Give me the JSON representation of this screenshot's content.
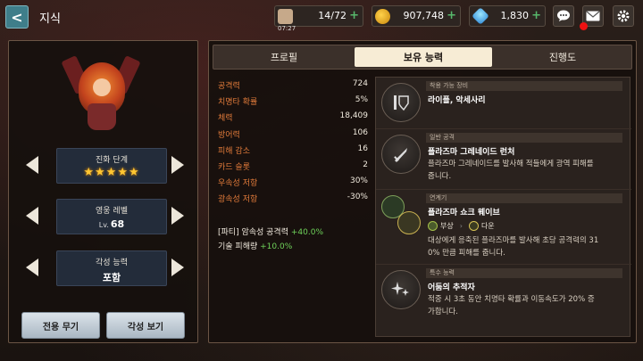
{
  "header": {
    "back_label": "<",
    "title": "지식"
  },
  "resources": {
    "stamina": {
      "value": "14/72",
      "timer": "07:27",
      "icon": "coffee-icon"
    },
    "gold": {
      "value": "907,748",
      "icon": "gold-coin-icon"
    },
    "gem": {
      "value": "1,830",
      "icon": "gem-icon"
    },
    "plus": "+"
  },
  "top_icons": [
    "chat-icon",
    "mail-icon",
    "gear-icon"
  ],
  "left": {
    "evolution_label": "진화 단계",
    "evolution_stars": "★★★★★",
    "level_label": "영웅 레벨",
    "level_prefix": "Lv.",
    "level_value": "68",
    "awaken_label": "각성 능력",
    "awaken_value": "포함",
    "btn_weapon": "전용 무기",
    "btn_awaken": "각성 보기"
  },
  "tabs": [
    "프로필",
    "보유 능력",
    "진행도"
  ],
  "stats": [
    {
      "name": "공격력",
      "value": "724"
    },
    {
      "name": "치명타 확률",
      "value": "5%"
    },
    {
      "name": "체력",
      "value": "18,409"
    },
    {
      "name": "방어력",
      "value": "106"
    },
    {
      "name": "피해 감소",
      "value": "16"
    },
    {
      "name": "카드 슬롯",
      "value": "2"
    },
    {
      "name": "우속성 저항",
      "value": "30%"
    },
    {
      "name": "광속성 저항",
      "value": "-30%"
    }
  ],
  "bonus": {
    "party_prefix": "[파티] 암속성 공격력 ",
    "party_value": "+40.0%",
    "skill_prefix": "기술 피해량 ",
    "skill_value": "+10.0%"
  },
  "abilities": {
    "equip": {
      "tag": "착용 가능 장비",
      "title": "라이플, 악세사리"
    },
    "normal": {
      "tag": "일반 공격",
      "title": "플라즈마 그레네이드 런처",
      "desc1": "플라즈마 그레네이드를 발사해 적들에게 광역 피해를",
      "desc2": "줍니다."
    },
    "chain": {
      "tag": "연계기",
      "title": "플라즈마 쇼크 웨이브",
      "from": "부상",
      "to": "다운",
      "desc1": "대상에게 응축된 플라즈마를 발사해 초당 공격력의 31",
      "desc2": "0% 만큼 피해를 줍니다."
    },
    "special": {
      "tag": "특수 능력",
      "title": "어둠의 추적자",
      "desc1": "적중 시 3초 동안 치명타 확률과 이동속도가 20% 증",
      "desc2": "가합니다."
    }
  }
}
